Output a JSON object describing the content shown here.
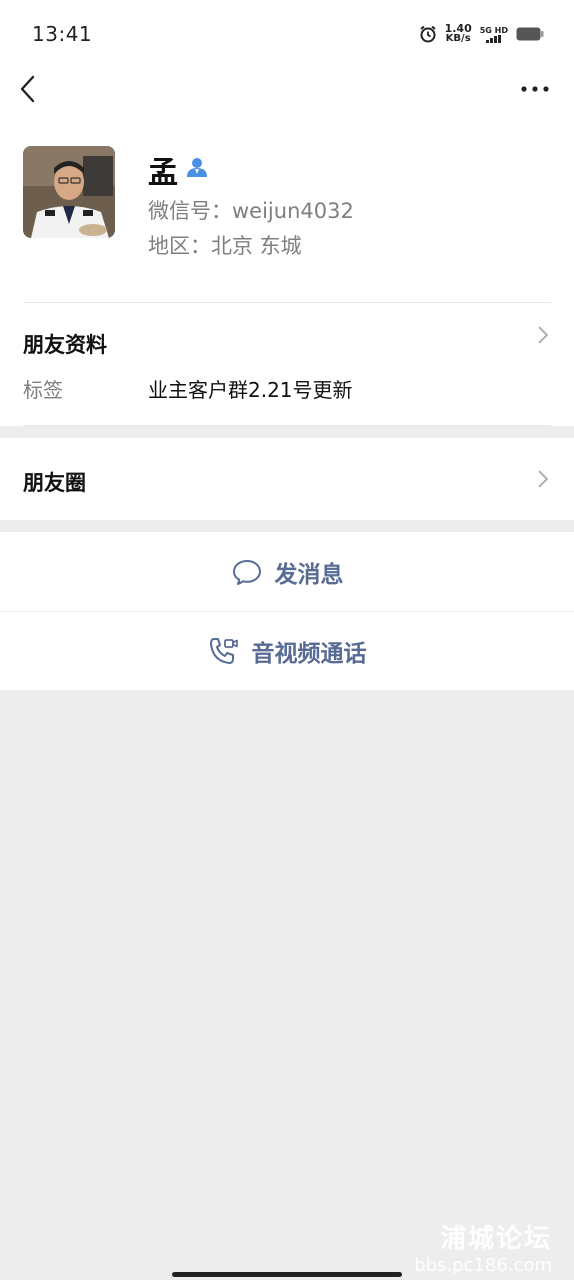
{
  "status_bar": {
    "time": "13:41",
    "net_speed_value": "1.40",
    "net_speed_unit": "KB/s",
    "signal_label": "5G HD",
    "icons": [
      "alarm-icon",
      "signal-icon",
      "battery-icon"
    ]
  },
  "nav": {
    "back_icon": "chevron-left-icon",
    "more_icon": "more-dots-icon"
  },
  "profile": {
    "name": "孟",
    "wechat_id": "微信号：weijun4032",
    "region": "地区：北京  东城",
    "avatar_icon": "avatar",
    "verified_icon": "contact-person-icon"
  },
  "friend_info": {
    "title": "朋友资料",
    "tag_label": "标签",
    "tag_value": "业主客户群2.21号更新"
  },
  "moments": {
    "title": "朋友圈"
  },
  "actions": {
    "message": "发消息",
    "call": "音视频通话"
  },
  "watermark": {
    "title": "浦城论坛",
    "url": "bbs.pc186.com"
  },
  "colors": {
    "accent": "#576b95",
    "background": "#ededed",
    "card": "#ffffff"
  }
}
